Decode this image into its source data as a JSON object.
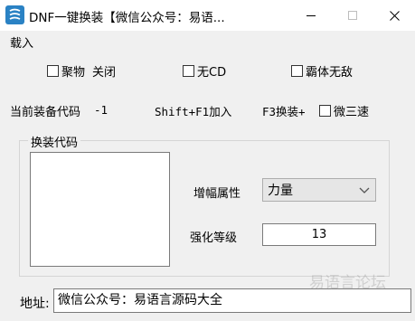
{
  "window": {
    "title": "DNF一键换装【微信公众号：易语...",
    "app_icon": "app-logo-icon",
    "controls": [
      "minimize-icon",
      "maximize-icon",
      "close-icon"
    ]
  },
  "menu": {
    "load_label": "载入"
  },
  "options": {
    "gather_label": "聚物",
    "gather_state": "关闭",
    "no_cd_label": "无CD",
    "invincible_label": "霸体无敌"
  },
  "status": {
    "current_code_label": "当前装备代码",
    "current_code_value": "-1",
    "shift_hotkey": "Shift+F1加入",
    "f3_hotkey": "F3换装+",
    "triple_speed_label": "微三速"
  },
  "swap_group": {
    "title": "换装代码",
    "code_text": "",
    "attr_label": "增幅属性",
    "attr_selected": "力量",
    "level_label": "强化等级",
    "level_value": "13"
  },
  "address": {
    "label": "地址:",
    "value": "微信公众号：易语言源码大全"
  },
  "watermark": "易语言论坛"
}
